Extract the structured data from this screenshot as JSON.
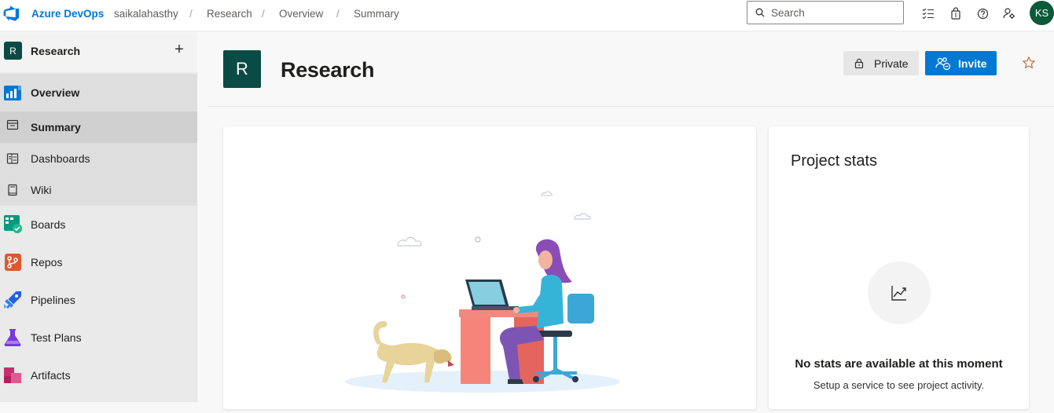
{
  "topbar": {
    "brand": "Azure DevOps",
    "breadcrumb": [
      "saikalahasthy",
      "Research",
      "Overview",
      "Summary"
    ],
    "separator": "/",
    "search_placeholder": "Search",
    "avatar_initials": "KS",
    "icons": [
      "task-list-icon",
      "shopping-bag-icon",
      "help-icon",
      "user-settings-icon"
    ]
  },
  "sidebar": {
    "project_initial": "R",
    "project_name": "Research",
    "add_symbol": "+",
    "items": [
      {
        "label": "Overview",
        "icon": "overview-icon"
      },
      {
        "label": "Summary",
        "icon": "summary-icon"
      },
      {
        "label": "Dashboards",
        "icon": "dashboards-icon"
      },
      {
        "label": "Wiki",
        "icon": "wiki-icon"
      },
      {
        "label": "Boards",
        "icon": "boards-icon"
      },
      {
        "label": "Repos",
        "icon": "repos-icon"
      },
      {
        "label": "Pipelines",
        "icon": "pipelines-icon"
      },
      {
        "label": "Test Plans",
        "icon": "test-plans-icon"
      },
      {
        "label": "Artifacts",
        "icon": "artifacts-icon"
      }
    ]
  },
  "header": {
    "project_initial": "R",
    "title": "Research",
    "private_label": "Private",
    "invite_label": "Invite"
  },
  "stats": {
    "title": "Project stats",
    "empty_message": "No stats are available at this moment",
    "empty_sub": "Setup a service to see project activity."
  },
  "colors": {
    "accent": "#0078d4",
    "project_badge": "#0b4b46",
    "avatar": "#0b5a3a"
  }
}
